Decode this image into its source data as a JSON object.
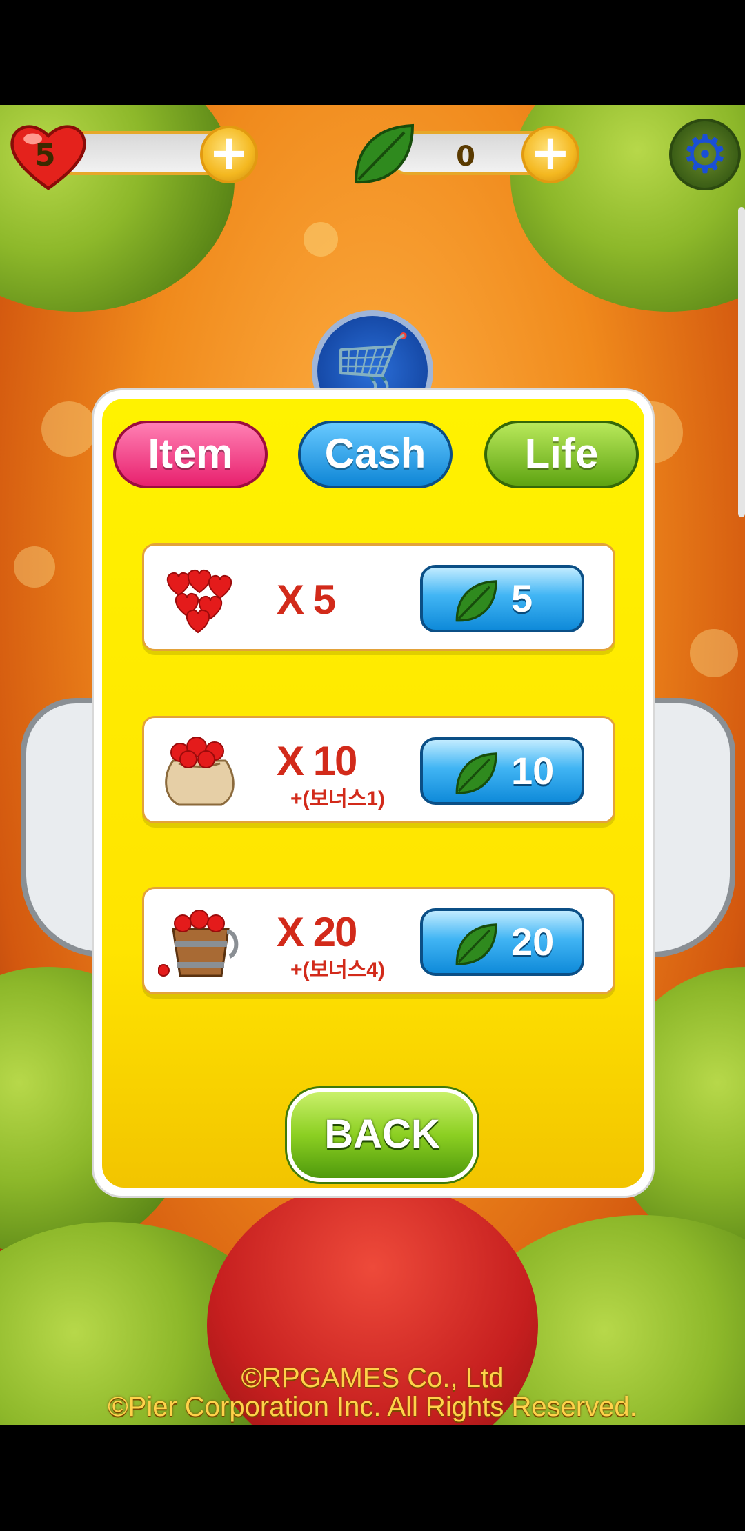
{
  "status": {
    "lives": "5",
    "leaves": "0"
  },
  "tabs": [
    {
      "label": "Item"
    },
    {
      "label": "Cash"
    },
    {
      "label": "Life"
    }
  ],
  "offers": [
    {
      "quantity": "X 5",
      "bonus": "",
      "price": "5"
    },
    {
      "quantity": "X 10",
      "bonus": "+(보너스1)",
      "price": "10"
    },
    {
      "quantity": "X 20",
      "bonus": "+(보너스4)",
      "price": "20"
    }
  ],
  "back_label": "BACK",
  "footer": {
    "line1": "©RPGAMES Co., Ltd",
    "line2": "©Pier Corporation Inc. All Rights Reserved."
  },
  "colors": {
    "dialog_yellow": "#ffe400",
    "tab_item": "#e8216e",
    "tab_cash": "#0f86d6",
    "tab_life": "#5fa412",
    "qty_red": "#d22a1a",
    "buy_blue": "#41b5f4"
  },
  "icons": {
    "lives": "heart-icon",
    "currency": "leaf-icon",
    "settings": "gear-icon",
    "shop": "shopping-cart-icon"
  }
}
